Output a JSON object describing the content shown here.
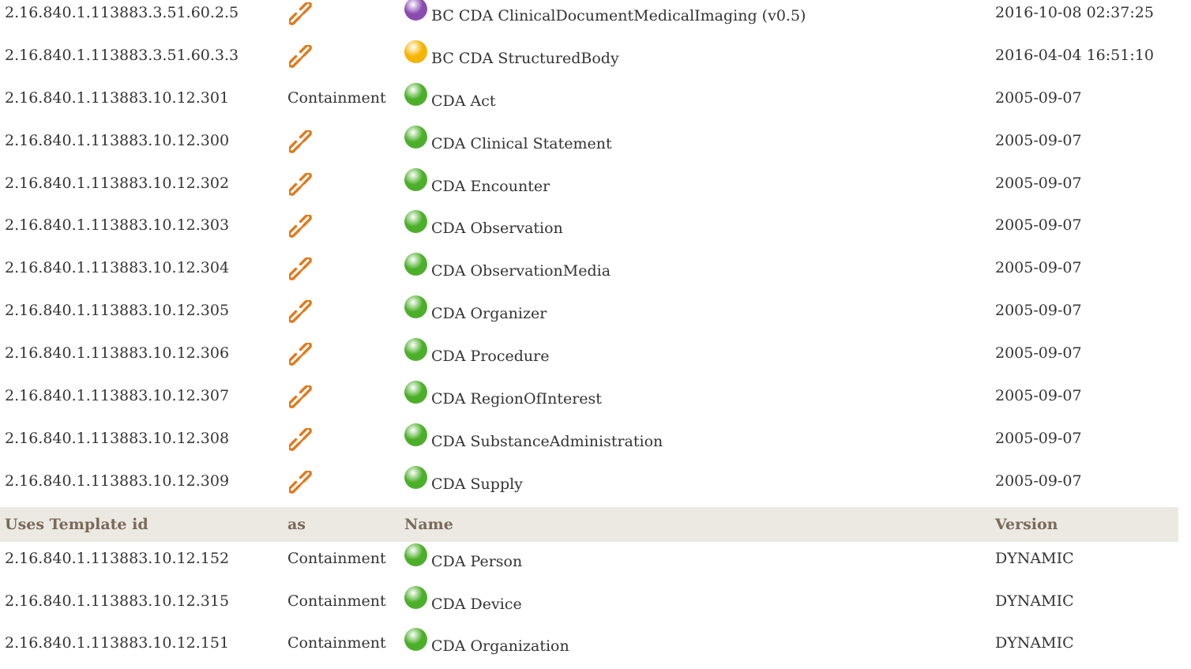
{
  "colors": {
    "green": "#4caf2a",
    "purple": "#8a4bb0",
    "yellow": "#f5b400",
    "link_icon": "#e07a1e",
    "header_bg": "#ece9e3",
    "header_text": "#7a6a5b"
  },
  "rows1": [
    {
      "id": "2.16.840.1.113883.3.51.60.2.5",
      "as": "",
      "icon": "link-icon",
      "status": "purple",
      "name": "BC CDA ClinicalDocumentMedicalImaging (v0.5)",
      "version": "2016-10-08 02:37:25"
    },
    {
      "id": "2.16.840.1.113883.3.51.60.3.3",
      "as": "",
      "icon": "link-icon",
      "status": "yellow",
      "name": "BC CDA StructuredBody",
      "version": "2016-04-04 16:51:10"
    },
    {
      "id": "2.16.840.1.113883.10.12.301",
      "as": "Containment",
      "icon": "",
      "status": "green",
      "name": "CDA Act",
      "version": "2005-09-07"
    },
    {
      "id": "2.16.840.1.113883.10.12.300",
      "as": "",
      "icon": "link-icon",
      "status": "green",
      "name": "CDA Clinical Statement",
      "version": "2005-09-07"
    },
    {
      "id": "2.16.840.1.113883.10.12.302",
      "as": "",
      "icon": "link-icon",
      "status": "green",
      "name": "CDA Encounter",
      "version": "2005-09-07"
    },
    {
      "id": "2.16.840.1.113883.10.12.303",
      "as": "",
      "icon": "link-icon",
      "status": "green",
      "name": "CDA Observation",
      "version": "2005-09-07"
    },
    {
      "id": "2.16.840.1.113883.10.12.304",
      "as": "",
      "icon": "link-icon",
      "status": "green",
      "name": "CDA ObservationMedia",
      "version": "2005-09-07"
    },
    {
      "id": "2.16.840.1.113883.10.12.305",
      "as": "",
      "icon": "link-icon",
      "status": "green",
      "name": "CDA Organizer",
      "version": "2005-09-07"
    },
    {
      "id": "2.16.840.1.113883.10.12.306",
      "as": "",
      "icon": "link-icon",
      "status": "green",
      "name": "CDA Procedure",
      "version": "2005-09-07"
    },
    {
      "id": "2.16.840.1.113883.10.12.307",
      "as": "",
      "icon": "link-icon",
      "status": "green",
      "name": "CDA RegionOfInterest",
      "version": "2005-09-07"
    },
    {
      "id": "2.16.840.1.113883.10.12.308",
      "as": "",
      "icon": "link-icon",
      "status": "green",
      "name": "CDA SubstanceAdministration",
      "version": "2005-09-07"
    },
    {
      "id": "2.16.840.1.113883.10.12.309",
      "as": "",
      "icon": "link-icon",
      "status": "green",
      "name": "CDA Supply",
      "version": "2005-09-07"
    }
  ],
  "header": {
    "col1": "Uses Template id",
    "col2": "as",
    "col3": "Name",
    "col4": "Version"
  },
  "rows2": [
    {
      "id": "2.16.840.1.113883.10.12.152",
      "as": "Containment",
      "icon": "",
      "status": "green",
      "name": "CDA Person",
      "version": "DYNAMIC"
    },
    {
      "id": "2.16.840.1.113883.10.12.315",
      "as": "Containment",
      "icon": "",
      "status": "green",
      "name": "CDA Device",
      "version": "DYNAMIC"
    },
    {
      "id": "2.16.840.1.113883.10.12.151",
      "as": "Containment",
      "icon": "",
      "status": "green",
      "name": "CDA Organization",
      "version": "DYNAMIC"
    }
  ]
}
